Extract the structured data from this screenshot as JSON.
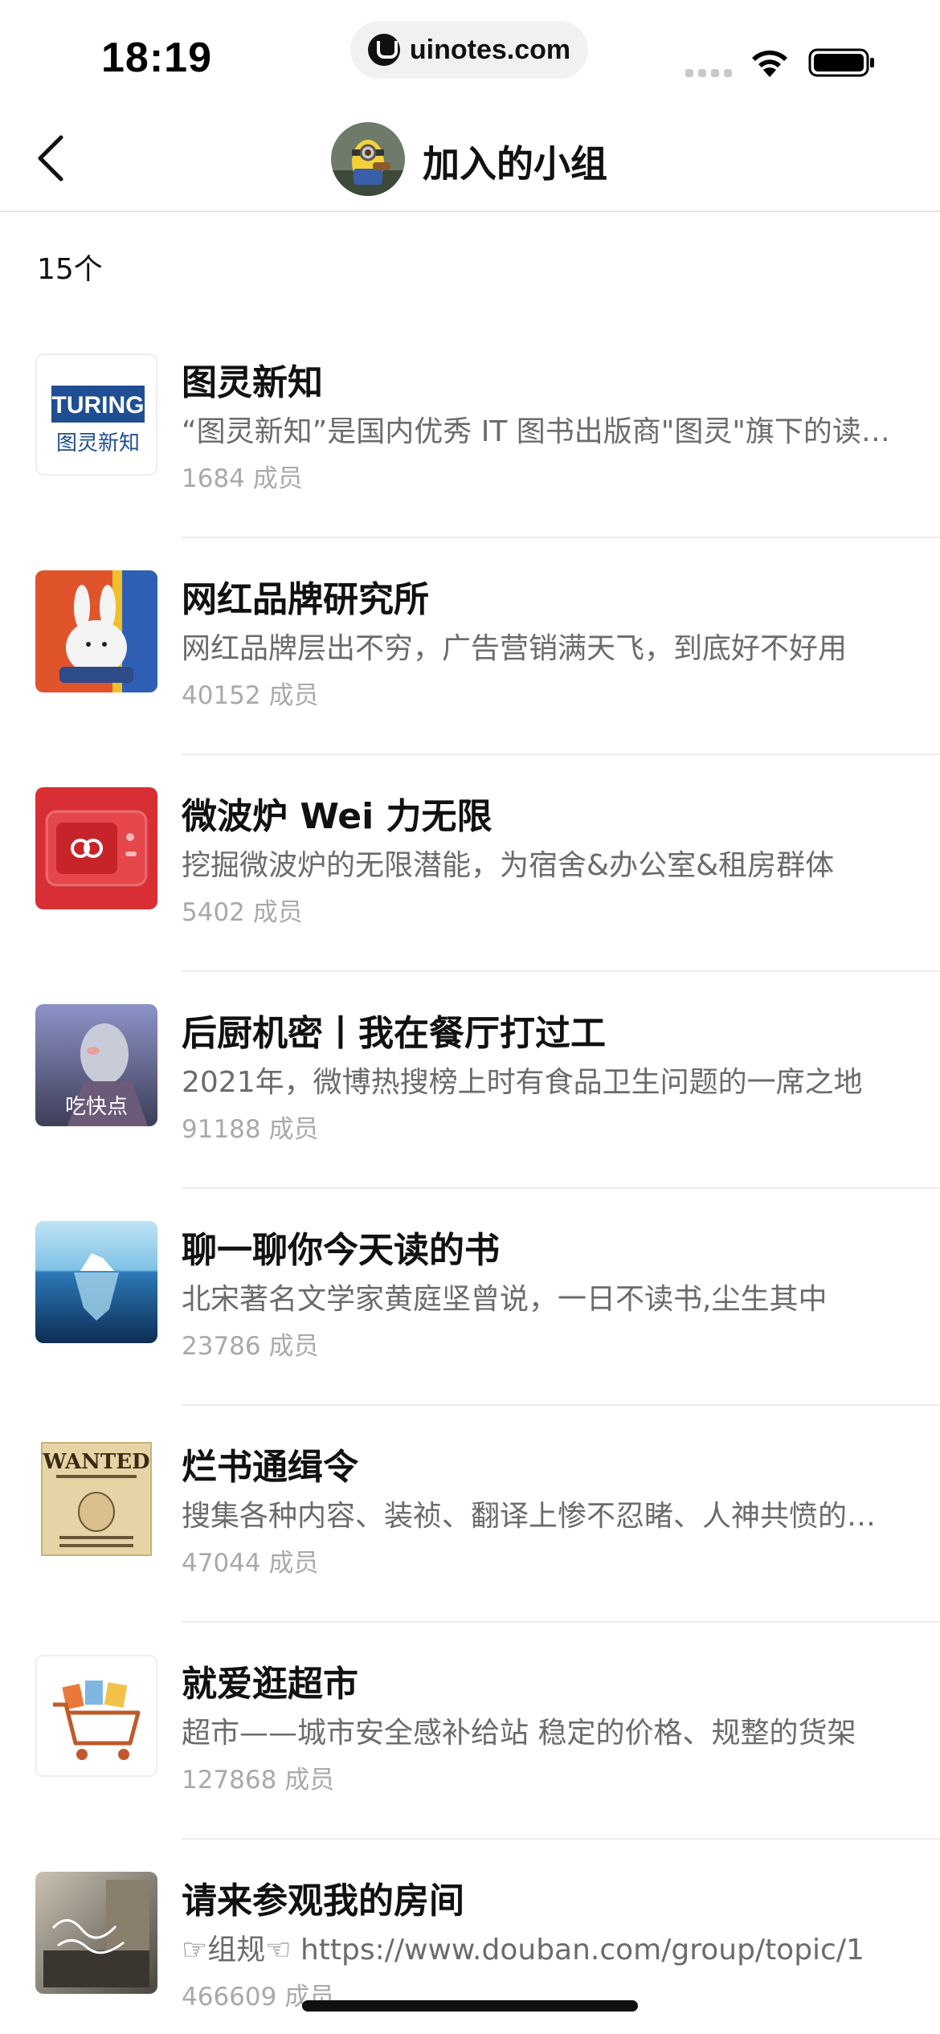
{
  "status_bar": {
    "time": "18:19",
    "url": "uinotes.com"
  },
  "nav": {
    "title": "加入的小组"
  },
  "count_label": "15个",
  "groups": [
    {
      "name": "图灵新知",
      "description": "“图灵新知”是国内优秀 IT 图书出版商\"图灵\"旗下的读书小组",
      "members": "1684 成员",
      "thumb_text_top": "TURING",
      "thumb_text_bottom": "图灵新知"
    },
    {
      "name": "网红品牌研究所",
      "description": "网红品牌层出不穷，广告营销满天飞，到底好不好用",
      "members": "40152 成员"
    },
    {
      "name": "微波炉 Wei 力无限",
      "description": "挖掘微波炉的无限潜能，为宿舍&办公室&租房群体",
      "members": "5402 成员"
    },
    {
      "name": "后厨机密丨我在餐厅打过工",
      "description": "2021年，微博热搜榜上时有食品卫生问题的一席之地",
      "members": "91188 成员",
      "thumb_label": "吃快点"
    },
    {
      "name": "聊一聊你今天读的书",
      "description": "北宋著名文学家黄庭坚曾说，一日不读书,尘生其中",
      "members": "23786 成员"
    },
    {
      "name": "烂书通缉令",
      "description": "搜集各种内容、装祯、翻译上惨不忍睹、人神共愤的烂书",
      "members": "47044 成员",
      "thumb_text_top": "WANTED"
    },
    {
      "name": "就爱逛超市",
      "description": "超市——城市安全感补给站 稳定的价格、规整的货架",
      "members": "127868 成员"
    },
    {
      "name": "请来参观我的房间",
      "description": "☞组规☜ https://www.douban.com/group/topic/1",
      "members": "466609 成员"
    }
  ]
}
